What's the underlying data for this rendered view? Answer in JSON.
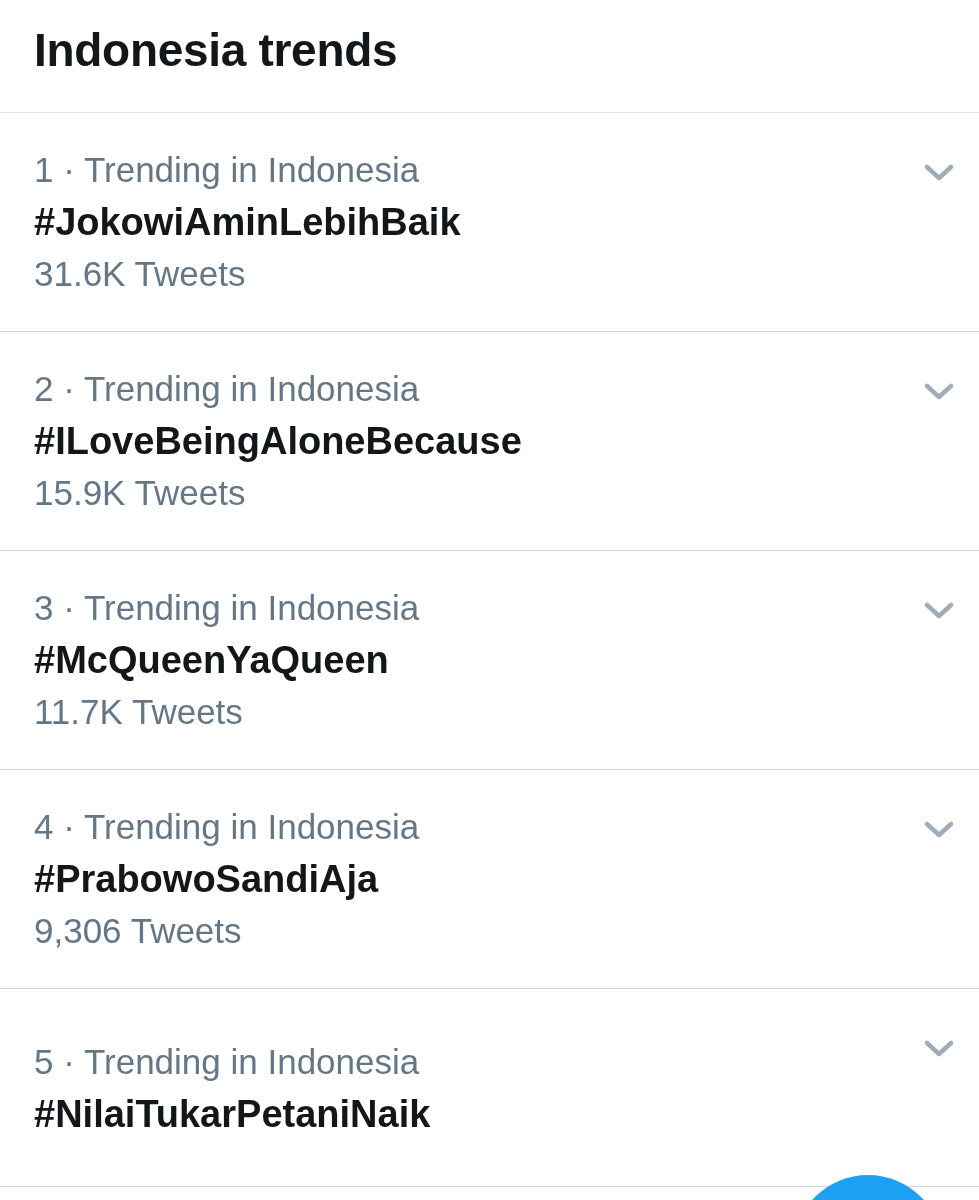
{
  "header": {
    "title": "Indonesia trends"
  },
  "trends": [
    {
      "context": "1 · Trending in Indonesia",
      "hashtag": "#JokowiAminLebihBaik",
      "tweet_count": "31.6K Tweets"
    },
    {
      "context": "2 · Trending in Indonesia",
      "hashtag": "#ILoveBeingAloneBecause",
      "tweet_count": "15.9K Tweets"
    },
    {
      "context": "3 · Trending in Indonesia",
      "hashtag": "#McQueenYaQueen",
      "tweet_count": "11.7K Tweets"
    },
    {
      "context": "4 · Trending in Indonesia",
      "hashtag": "#PrabowoSandiAja",
      "tweet_count": "9,306 Tweets"
    },
    {
      "context": "5 · Trending in Indonesia",
      "hashtag": "#NilaiTukarPetaniNaik"
    }
  ]
}
